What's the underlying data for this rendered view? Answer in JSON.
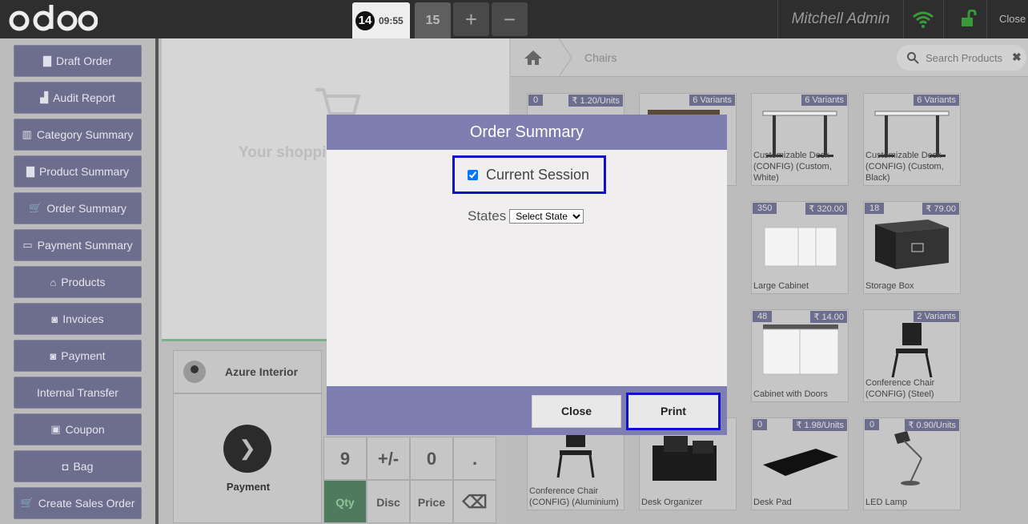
{
  "header": {
    "logo_text": "odoo",
    "active_order": {
      "number": "14",
      "time": "09:55"
    },
    "other_order": "15",
    "add_order_label": "+",
    "remove_order_label": "−",
    "user_name": "Mitchell Admin",
    "close_label": "Close",
    "wifi_color": "#3a9a3a",
    "lock_color": "#3a9a3a"
  },
  "sidebar": {
    "items": [
      {
        "label": "Draft Order",
        "icon": "file-icon",
        "glyph": "▇"
      },
      {
        "label": "Audit Report",
        "icon": "bar-chart-icon",
        "glyph": "▟"
      },
      {
        "label": "Category Summary",
        "icon": "bar-chart-icon",
        "glyph": "▥"
      },
      {
        "label": "Product Summary",
        "icon": "book-icon",
        "glyph": "▇"
      },
      {
        "label": "Order Summary",
        "icon": "cart-icon",
        "glyph": "🛒"
      },
      {
        "label": "Payment Summary",
        "icon": "credit-card-icon",
        "glyph": "▭"
      },
      {
        "label": "Products",
        "icon": "bank-icon",
        "glyph": "⌂"
      },
      {
        "label": "Invoices",
        "icon": "money-icon",
        "glyph": "◙"
      },
      {
        "label": "Payment",
        "icon": "money-icon",
        "glyph": "◙"
      },
      {
        "label": "Internal Transfer",
        "icon": "",
        "glyph": ""
      },
      {
        "label": "Coupon",
        "icon": "gift-icon",
        "glyph": "▣"
      },
      {
        "label": "Bag",
        "icon": "shopping-bag-icon",
        "glyph": "◘"
      },
      {
        "label": "Create Sales Order",
        "icon": "cart-icon",
        "glyph": "🛒"
      }
    ]
  },
  "order": {
    "empty_text": "Your shoppi",
    "customer_name": "Azure Interior",
    "payment_label": "Payment",
    "numpad": {
      "nine": "9",
      "plus_minus": "+/-",
      "zero": "0",
      "dot": ".",
      "qty": "Qty",
      "disc": "Disc",
      "price": "Price",
      "backspace": "⌫"
    }
  },
  "products": {
    "breadcrumb": "Chairs",
    "search_placeholder": "Search Products",
    "search_clear": "✖",
    "items": [
      {
        "qty": "0",
        "price": "₹ 1.20/Units",
        "name": ""
      },
      {
        "qty": "",
        "price": "6 Variants",
        "name": ""
      },
      {
        "qty": "",
        "price": "6 Variants",
        "name": "Customizable Desk (CONFIG) (Custom, White)"
      },
      {
        "qty": "",
        "price": "6 Variants",
        "name": "Customizable Desk (CONFIG) (Custom, Black)"
      },
      {
        "qty": "350",
        "price": "₹ 320.00",
        "name": "Large Cabinet"
      },
      {
        "qty": "18",
        "price": "₹ 79.00",
        "name": "Storage Box"
      },
      {
        "qty": "48",
        "price": "₹ 14.00",
        "name": "Cabinet with Doors"
      },
      {
        "qty": "",
        "price": "2 Variants",
        "name": "Conference Chair (CONFIG) (Steel)"
      },
      {
        "qty": "",
        "price": "",
        "name": "Conference Chair (CONFIG) (Aluminium)"
      },
      {
        "qty": "",
        "price": "",
        "name": "Desk Organizer"
      },
      {
        "qty": "0",
        "price": "₹ 1.98/Units",
        "name": "Desk Pad"
      },
      {
        "qty": "0",
        "price": "₹ 0.90/Units",
        "name": "LED Lamp"
      }
    ]
  },
  "modal": {
    "title": "Order Summary",
    "current_session_label": "Current Session",
    "current_session_checked": true,
    "states_label": "States",
    "state_select_value": "Select State",
    "close_label": "Close",
    "print_label": "Print",
    "header_color": "#7e7fb0",
    "highlight_color": "#1010cc"
  }
}
